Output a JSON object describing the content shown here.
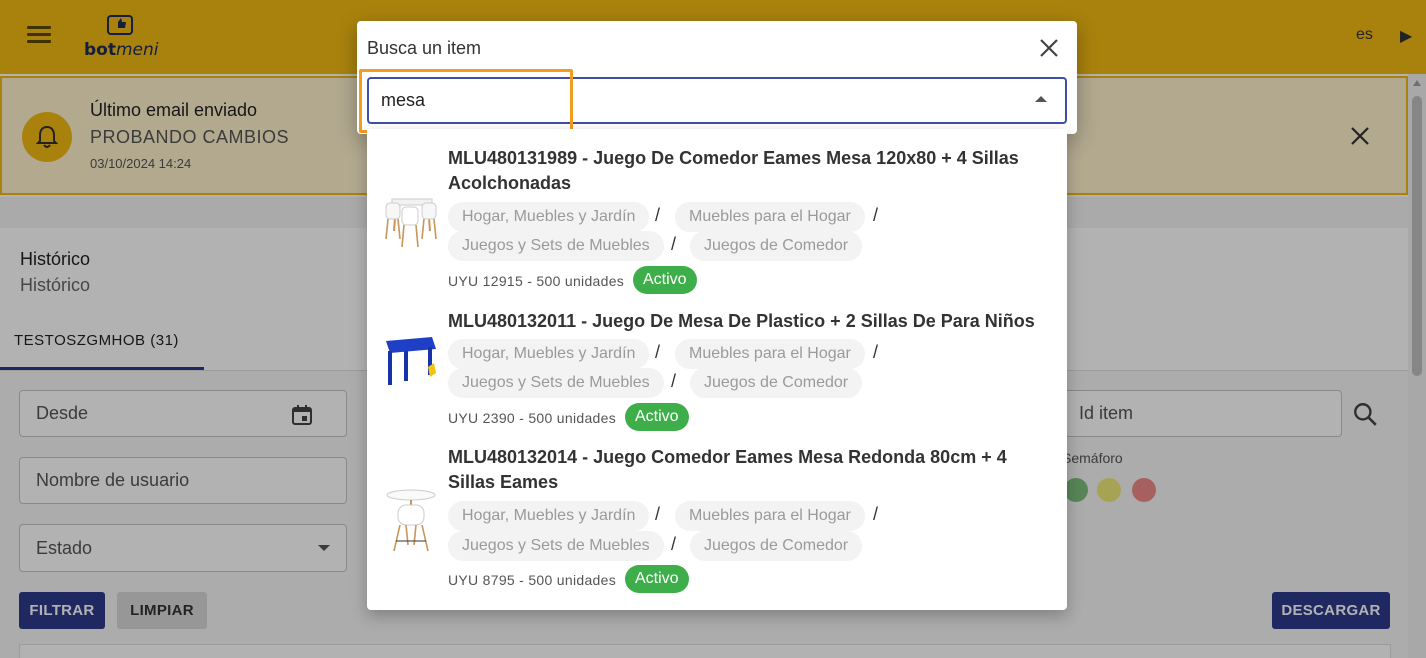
{
  "app": {
    "logo_text_1": "bot",
    "logo_text_2": "meni",
    "language": "es",
    "colors": {
      "brand": "#f3ba13",
      "primary": "#2d3a8c",
      "success": "#3dae49",
      "highlight": "#f39c1f"
    }
  },
  "banner": {
    "title": "Último email enviado",
    "subtitle": "PROBANDO CAMBIOS",
    "date": "03/10/2024 14:24",
    "icon": "bell-icon"
  },
  "history": {
    "title": "Histórico",
    "subtitle": "Histórico",
    "tab_label": "TESTOSZGMHOB (31)"
  },
  "filters": {
    "desde_label": "Desde",
    "usuario_label": "Nombre de usuario",
    "estado_label": "Estado",
    "id_item_label": "Id item",
    "semaforo_label": "Semáforo",
    "filtrar_label": "FILTRAR",
    "limpiar_label": "LIMPIAR",
    "descargar_label": "DESCARGAR"
  },
  "dialog": {
    "title": "Busca un item",
    "search_value": "mesa",
    "results": [
      {
        "title": "MLU480131989 - Juego De Comedor Eames Mesa 120x80 + 4 Sillas Acolchonadas",
        "categories": [
          "Hogar, Muebles y Jardín",
          "Muebles para el Hogar",
          "Juegos y Sets de Muebles",
          "Juegos de Comedor"
        ],
        "price": "UYU 12915 - 500 unidades",
        "status": "Activo"
      },
      {
        "title": "MLU480132011 - Juego De Mesa De Plastico + 2 Sillas De Para Niños",
        "categories": [
          "Hogar, Muebles y Jardín",
          "Muebles para el Hogar",
          "Juegos y Sets de Muebles",
          "Juegos de Comedor"
        ],
        "price": "UYU 2390 - 500 unidades",
        "status": "Activo"
      },
      {
        "title": "MLU480132014 - Juego Comedor Eames Mesa Redonda 80cm + 4 Sillas Eames",
        "categories": [
          "Hogar, Muebles y Jardín",
          "Muebles para el Hogar",
          "Juegos y Sets de Muebles",
          "Juegos de Comedor"
        ],
        "price": "UYU 8795 - 500 unidades",
        "status": "Activo"
      }
    ]
  }
}
